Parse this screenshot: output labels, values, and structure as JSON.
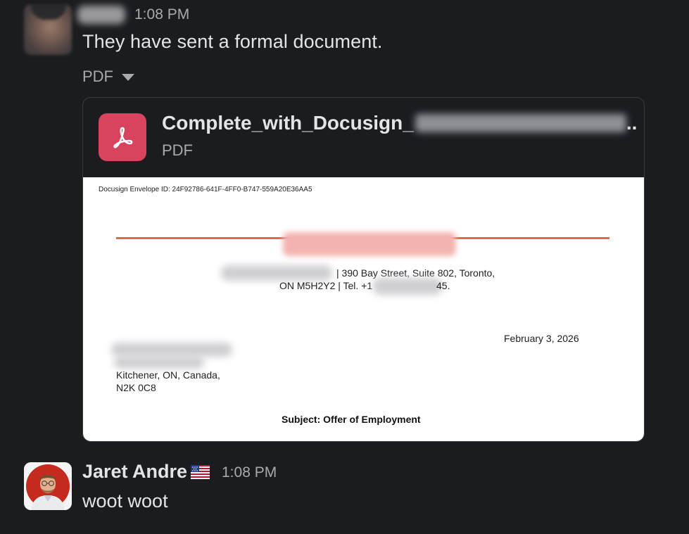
{
  "messages": [
    {
      "time": "1:08 PM",
      "text": "They have sent a formal document.",
      "attachment_toggle": "PDF",
      "attachment": {
        "file_name_visible": "Complete_with_Docusign_",
        "file_name_suffix": "..",
        "file_type": "PDF",
        "icon": "pdf-icon",
        "icon_color": "#d8435e",
        "preview": {
          "envelope_id": "Docusign Envelope ID: 24F92786-641F-4FF0-B747-559A20E36AA5",
          "address_line1": "|  390 Bay Street, Suite 802, Toronto,",
          "address_line2_start": "ON M5H2Y2 | Tel. +1",
          "address_line2_end": "45.",
          "date": "February 3, 2026",
          "recipient_city": "Kitchener, ON, Canada,",
          "recipient_postal": "N2K 0C8",
          "subject": "Subject: Offer of Employment",
          "accent_color": "#e06a4a"
        }
      }
    },
    {
      "sender": "Jaret Andre",
      "status_emoji": "us-flag-icon",
      "time": "1:08 PM",
      "text": "woot woot"
    }
  ],
  "colors": {
    "background": "#1b1c20",
    "text_primary": "#e3e4e6",
    "text_secondary": "#a9aaad"
  }
}
